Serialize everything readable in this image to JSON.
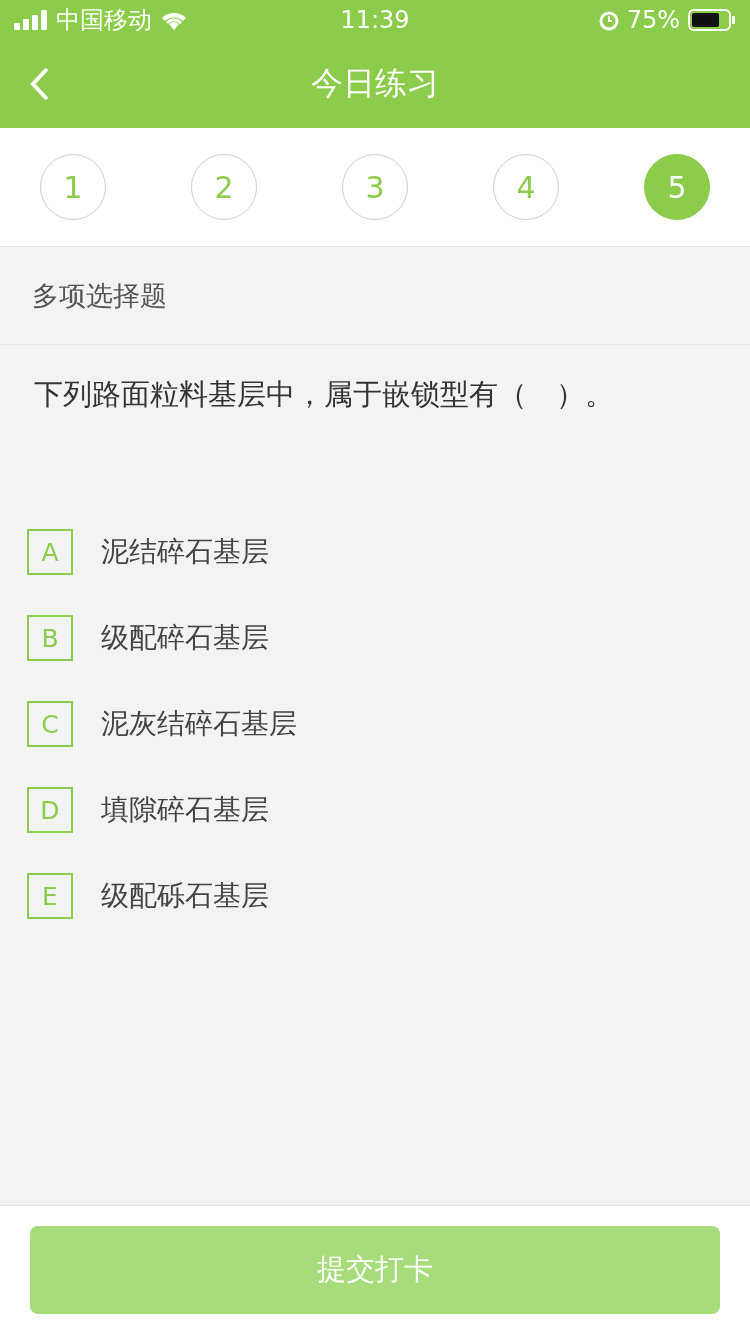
{
  "status_bar": {
    "carrier": "中国移动",
    "time": "11:39",
    "battery": "75%"
  },
  "nav": {
    "title": "今日练习"
  },
  "questions": [
    {
      "label": "1",
      "selected": false
    },
    {
      "label": "2",
      "selected": false
    },
    {
      "label": "3",
      "selected": false
    },
    {
      "label": "4",
      "selected": false
    },
    {
      "label": "5",
      "selected": true
    }
  ],
  "question_type": "多项选择题",
  "question": "下列路面粒料基层中，属于嵌锁型有（　）。",
  "options": [
    {
      "letter": "A",
      "text": "泥结碎石基层",
      "selected": false
    },
    {
      "letter": "B",
      "text": "级配碎石基层",
      "selected": false
    },
    {
      "letter": "C",
      "text": "泥灰结碎石基层",
      "selected": false
    },
    {
      "letter": "D",
      "text": "填隙碎石基层",
      "selected": false
    },
    {
      "letter": "E",
      "text": "级配砾石基层",
      "selected": false
    }
  ],
  "submit": {
    "label": "提交打卡",
    "disabled": true
  }
}
